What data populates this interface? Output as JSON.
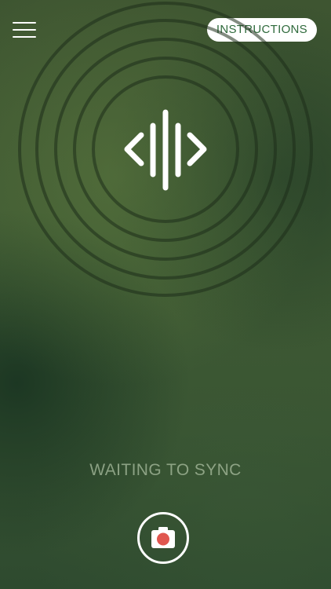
{
  "header": {
    "menu_icon": "hamburger-menu-icon",
    "instructions_label": "INSTRUCTIONS"
  },
  "main": {
    "sync_icon": "audio-sync-waveform-icon",
    "status_text": "WAITING TO SYNC"
  },
  "footer": {
    "camera_icon": "camera-icon"
  },
  "colors": {
    "accent": "#2f6a3c",
    "background": "#3e5531",
    "record_dot": "#e0564f",
    "status_text": "#aabea0"
  }
}
